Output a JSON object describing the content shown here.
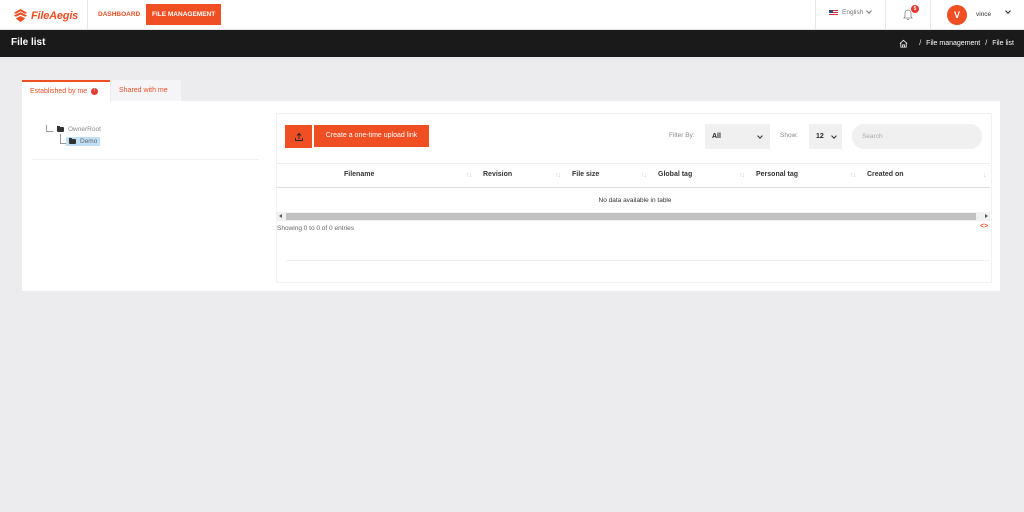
{
  "app": {
    "logo_text": "FileAegis"
  },
  "nav": {
    "items": [
      {
        "label": "DASHBOARD",
        "active": false
      },
      {
        "label": "FILE MANAGEMENT",
        "active": true
      }
    ]
  },
  "header": {
    "language": "English",
    "notifications_count": "5",
    "user_initial": "V",
    "username": "vince"
  },
  "titlebar": {
    "title": "File list",
    "breadcrumb": [
      "File management",
      "File list"
    ],
    "separator": "/"
  },
  "tabs": [
    {
      "label": "Established by me",
      "badge": "!",
      "active": true
    },
    {
      "label": "Shared with me",
      "active": false
    }
  ],
  "tree": {
    "root": "OwnerRoot",
    "children": [
      {
        "label": "Demo",
        "selected": true
      }
    ]
  },
  "toolbar": {
    "upload_icon": "upload-icon",
    "link_button": "Create a one-time upload link",
    "filter_label": "Filter By:",
    "filter_value": "All",
    "show_label": "Show:",
    "show_value": "12",
    "search_placeholder": "Search"
  },
  "table": {
    "columns": [
      "Filename",
      "Revision",
      "File size",
      "Global tag",
      "Personal tag",
      "Created on"
    ],
    "empty_message": "No data available in table",
    "info": "Showing 0 to 0 of 0 entries",
    "code_icon": "<>"
  },
  "colors": {
    "accent": "#f04e23",
    "titlebar": "#1a1a1a",
    "background": "#ececef"
  }
}
